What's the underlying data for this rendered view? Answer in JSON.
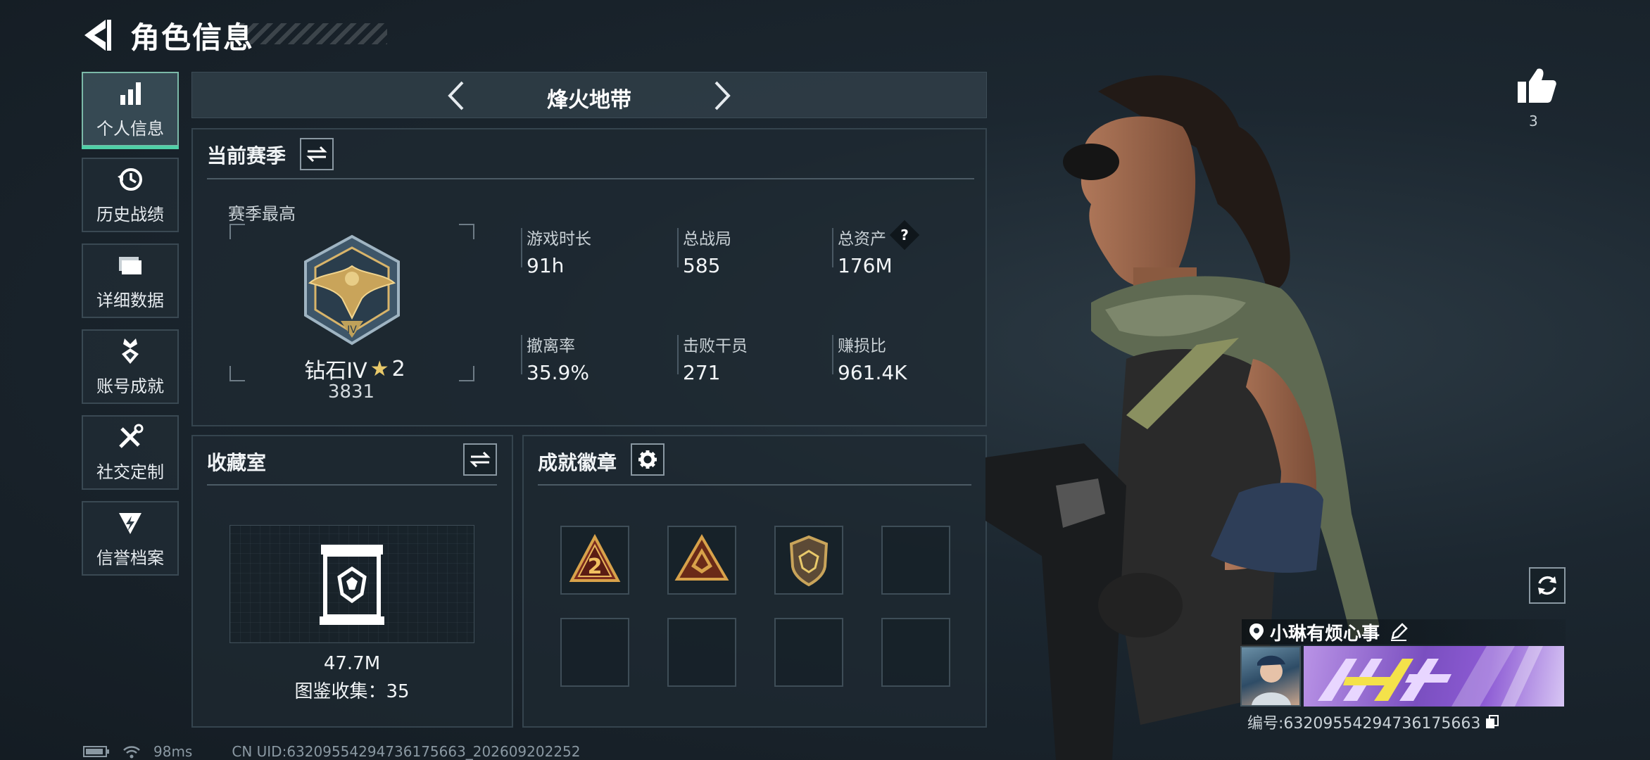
{
  "header": {
    "title": "角色信息"
  },
  "sidebar": {
    "items": [
      {
        "label": "个人信息",
        "icon": "bar-chart-icon",
        "active": true
      },
      {
        "label": "历史战绩",
        "icon": "history-icon",
        "active": false
      },
      {
        "label": "详细数据",
        "icon": "folder-icon",
        "active": false
      },
      {
        "label": "账号成就",
        "icon": "medal-icon",
        "active": false
      },
      {
        "label": "社交定制",
        "icon": "tools-icon",
        "active": false
      },
      {
        "label": "信誉档案",
        "icon": "shield-bolt-icon",
        "active": false
      }
    ]
  },
  "mode": {
    "title": "烽火地带"
  },
  "season": {
    "title": "当前赛季",
    "best_label": "赛季最高",
    "rank_name": "钻石IV",
    "rank_stars": "2",
    "rank_score": "3831",
    "stats": [
      {
        "label": "游戏时长",
        "value": "91h"
      },
      {
        "label": "总战局",
        "value": "585"
      },
      {
        "label": "总资产",
        "value": "176M",
        "help": "?"
      },
      {
        "label": "撤离率",
        "value": "35.9%"
      },
      {
        "label": "击败干员",
        "value": "271"
      },
      {
        "label": "赚损比",
        "value": "961.4K"
      }
    ]
  },
  "collection": {
    "title": "收藏室",
    "value": "47.7M",
    "collected_text": "图鉴收集：35"
  },
  "achievements": {
    "title": "成就徽章",
    "badges": [
      "badge-rank2-icon",
      "badge-triangle-icon",
      "badge-shield-icon",
      "",
      "",
      "",
      "",
      ""
    ]
  },
  "profile": {
    "likes": "3",
    "player_name": "小琳有烦心事",
    "player_id": "编号:63209554294736175663"
  },
  "footer": {
    "latency": "98ms",
    "uid": "CN UID:63209554294736175663_202609202252"
  },
  "colors": {
    "accent": "#4fd0a7",
    "panel": "#1e2a32",
    "gold": "#c9a45a"
  }
}
